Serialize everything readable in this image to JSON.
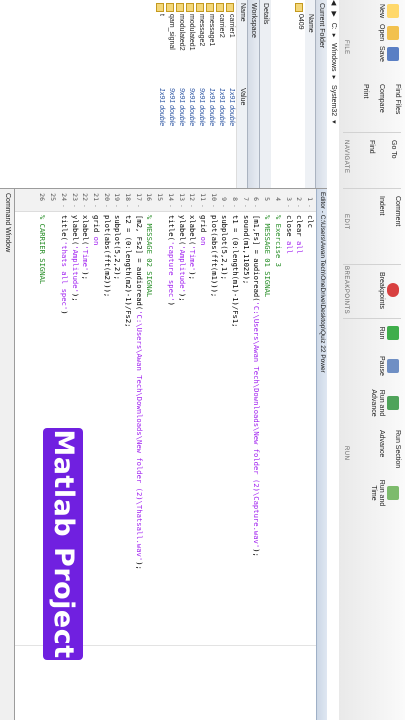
{
  "toolstrip": {
    "file": {
      "new_label": "New",
      "open_label": "Open",
      "save_label": "Save",
      "find_files_label": "Find Files",
      "compare_label": "Compare",
      "print_label": "Print",
      "section": "FILE"
    },
    "navigate": {
      "goto_label": "Go To",
      "find_label": "Find",
      "section": "NAVIGATE"
    },
    "edit": {
      "comment_label": "Comment",
      "indent_label": "Indent",
      "section": "EDIT"
    },
    "breakpoints": {
      "label": "Breakpoints",
      "section": "BREAKPOINTS"
    },
    "run": {
      "run_label": "Run",
      "run_advance_label": "Run and Advance",
      "run_section_label": "Run Section",
      "advance_label": "Advance",
      "run_time_label": "Run and Time",
      "pause_label": "Pause",
      "section": "RUN"
    }
  },
  "address": [
    "C:",
    "Windows",
    "System32"
  ],
  "current_folder": {
    "title": "Current Folder",
    "col_name": "Name",
    "items": [
      "0409"
    ],
    "details_label": "Details"
  },
  "workspace": {
    "title": "Workspace",
    "col_name": "Name",
    "col_value": "Value",
    "rows": [
      {
        "name": "carrier1",
        "value": "1x91 double"
      },
      {
        "name": "carrier2",
        "value": "1x91 double"
      },
      {
        "name": "message1",
        "value": "1x91 double"
      },
      {
        "name": "message2",
        "value": "9x91 double"
      },
      {
        "name": "modulated1",
        "value": "9x91 double"
      },
      {
        "name": "modulated2",
        "value": "9x91 double"
      },
      {
        "name": "qam_signal",
        "value": "9x91 double"
      },
      {
        "name": "t",
        "value": "1x91 double"
      }
    ]
  },
  "editor": {
    "title": "Editor - C:\\Users\\Awan Tech\\OneDrive\\Desktop\\Quiz 22 Power",
    "lines": [
      {
        "n": "1",
        "mark": "-",
        "text": "clc"
      },
      {
        "n": "2",
        "mark": "-",
        "text": "clear all"
      },
      {
        "n": "3",
        "mark": "-",
        "text": "close all"
      },
      {
        "n": "4",
        "mark": "",
        "text": "% Exercise 3"
      },
      {
        "n": "5",
        "mark": "",
        "text": "% MESSAGE 01 SIGNAL"
      },
      {
        "n": "6",
        "mark": "-",
        "text": "[m1,Fs] = audioread('C:\\Users\\Awan Tech\\Downloads\\New folder (2)\\Capture.wav');"
      },
      {
        "n": "7",
        "mark": "-",
        "text": "sound(m1,11025);"
      },
      {
        "n": "8",
        "mark": "-",
        "text": "t1 = (0:length(m1)-1)/Fs1;"
      },
      {
        "n": "9",
        "mark": "-",
        "text": "subplot(5,2,1);"
      },
      {
        "n": "10",
        "mark": "-",
        "text": "plot(abs(fft(m1)));"
      },
      {
        "n": "11",
        "mark": "-",
        "text": "grid on"
      },
      {
        "n": "12",
        "mark": "-",
        "text": "xlabel('Time');"
      },
      {
        "n": "13",
        "mark": "-",
        "text": "ylabel('Amplitude');"
      },
      {
        "n": "14",
        "mark": "-",
        "text": "title('capture spec')"
      },
      {
        "n": "15",
        "mark": "",
        "text": ""
      },
      {
        "n": "16",
        "mark": "",
        "text": "% MESSAGE 02 SIGNAL"
      },
      {
        "n": "17",
        "mark": "-",
        "text": "[m2, Fs2] = audioread('C:\\Users\\Awan Tech\\Downloads\\New folder (2)\\Thatsall.wav');"
      },
      {
        "n": "18",
        "mark": "-",
        "text": "t2 = (0:length(m2)-1)/Fs2;"
      },
      {
        "n": "19",
        "mark": "-",
        "text": "subplot(5,2,2);"
      },
      {
        "n": "20",
        "mark": "-",
        "text": "plot(abs(fft(m2)));"
      },
      {
        "n": "21",
        "mark": "-",
        "text": "grid on"
      },
      {
        "n": "22",
        "mark": "-",
        "text": "xlabel('Time');"
      },
      {
        "n": "23",
        "mark": "-",
        "text": "ylabel('Amplitude');"
      },
      {
        "n": "24",
        "mark": "-",
        "text": "title('thats all spec')"
      },
      {
        "n": "25",
        "mark": "",
        "text": ""
      },
      {
        "n": "26",
        "mark": "",
        "text": "% CARRIER SIGNAL"
      }
    ]
  },
  "command_window": {
    "title": "Command Window"
  },
  "banner": {
    "text": "Matlab Project",
    "color": "#7020e0"
  }
}
